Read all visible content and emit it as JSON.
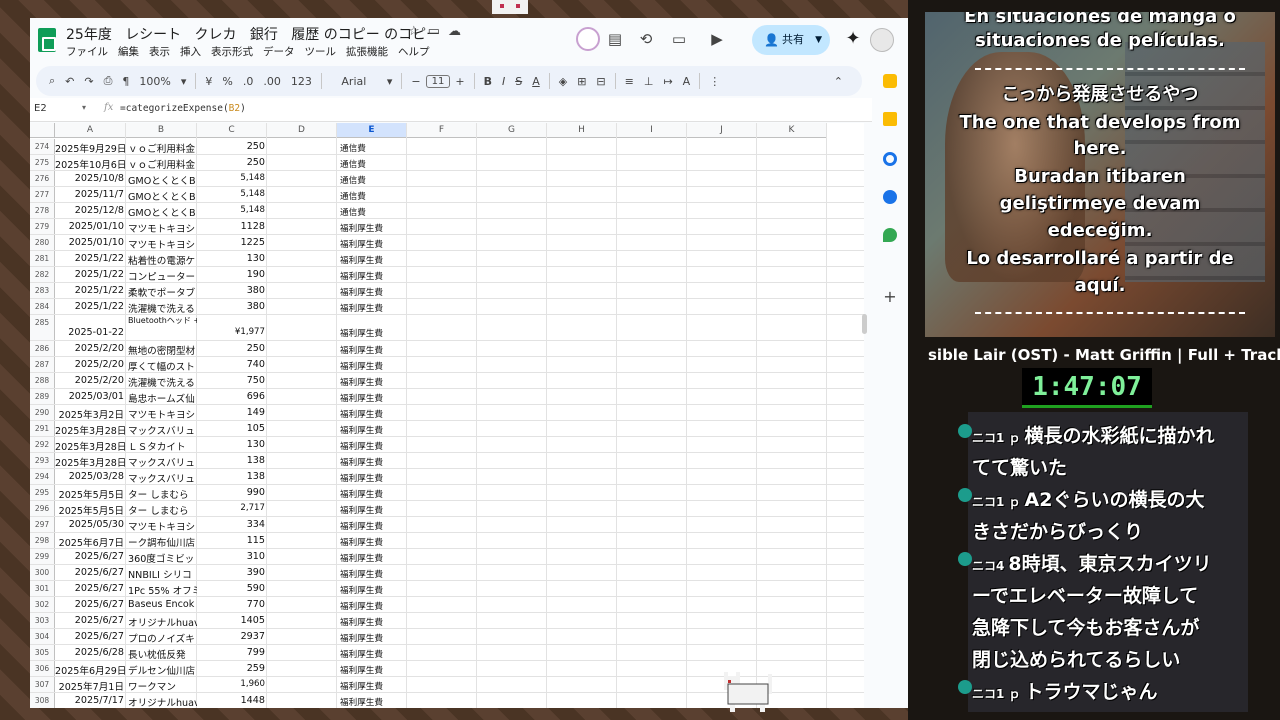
{
  "sheet": {
    "title_segments": [
      "25年度",
      "レシート",
      "クレカ",
      "銀行",
      "履歴 のコピー のコピー"
    ],
    "menu": [
      "ファイル",
      "編集",
      "表示",
      "挿入",
      "表示形式",
      "データ",
      "ツール",
      "拡張機能",
      "ヘルプ"
    ],
    "share_label": "共有",
    "toolbar": {
      "zoom": "100%",
      "currency": "¥",
      "percent": "%",
      "dec_decrease": ".0",
      "dec_increase": ".00",
      "number_format": "123",
      "font": "Arial",
      "font_size": "11"
    },
    "name_box": "E2",
    "formula_prefix": "=categorizeExpense(",
    "formula_ref": "B2",
    "formula_suffix": ")",
    "columns": [
      "A",
      "B",
      "C",
      "D",
      "E",
      "F",
      "G",
      "H",
      "I",
      "J",
      "K"
    ],
    "selected_column": "E",
    "rows": [
      {
        "n": "274",
        "a": "2025年9月29日",
        "b": "ｖｏご利用料金",
        "c": "250",
        "e": "通信費"
      },
      {
        "n": "275",
        "a": "2025年10月6日",
        "b": "ｖｏご利用料金",
        "c": "250",
        "e": "通信費"
      },
      {
        "n": "276",
        "a": "2025/10/8",
        "b": "GMOとくとくB",
        "c": "5,148",
        "e": "通信費"
      },
      {
        "n": "277",
        "a": "2025/11/7",
        "b": "GMOとくとくB",
        "c": "5,148",
        "e": "通信費"
      },
      {
        "n": "278",
        "a": "2025/12/8",
        "b": "GMOとくとくB",
        "c": "5,148",
        "e": "通信費"
      },
      {
        "n": "279",
        "a": "2025/01/10",
        "b": "マツモトキヨシ",
        "c": "1128",
        "e": "福利厚生費"
      },
      {
        "n": "280",
        "a": "2025/01/10",
        "b": "マツモトキヨシ",
        "c": "1225",
        "e": "福利厚生費"
      },
      {
        "n": "281",
        "a": "2025/1/22",
        "b": "粘着性の電源ケ",
        "c": "130",
        "e": "福利厚生費"
      },
      {
        "n": "282",
        "a": "2025/1/22",
        "b": "コンピューター",
        "c": "190",
        "e": "福利厚生費"
      },
      {
        "n": "283",
        "a": "2025/1/22",
        "b": "柔軟でポータブ",
        "c": "380",
        "e": "福利厚生費"
      },
      {
        "n": "284",
        "a": "2025/1/22",
        "b": "洗濯機で洗える",
        "c": "380",
        "e": "福利厚生費"
      },
      {
        "n": "285",
        "a": "2025-01-22",
        "b": "Bluetoothヘッド +1",
        "c": "¥1,977",
        "e": "福利厚生費",
        "tall": true
      },
      {
        "n": "286",
        "a": "2025/2/20",
        "b": "無地の密閉型材",
        "c": "250",
        "e": "福利厚生費"
      },
      {
        "n": "287",
        "a": "2025/2/20",
        "b": "厚くて幅のスト",
        "c": "740",
        "e": "福利厚生費"
      },
      {
        "n": "288",
        "a": "2025/2/20",
        "b": "洗濯機で洗える",
        "c": "750",
        "e": "福利厚生費"
      },
      {
        "n": "289",
        "a": "2025/03/01",
        "b": "島忠ホームズ仙",
        "c": "696",
        "e": "福利厚生費"
      },
      {
        "n": "290",
        "a": "2025年3月2日",
        "b": "マツモトキヨシ",
        "c": "149",
        "e": "福利厚生費"
      },
      {
        "n": "291",
        "a": "2025年3月28日",
        "b": "マックスバリュ",
        "c": "105",
        "e": "福利厚生費"
      },
      {
        "n": "292",
        "a": "2025年3月28日",
        "b": "ＬＳタカイト",
        "c": "130",
        "e": "福利厚生費"
      },
      {
        "n": "293",
        "a": "2025年3月28日",
        "b": "マックスバリュ",
        "c": "138",
        "e": "福利厚生費"
      },
      {
        "n": "294",
        "a": "2025/03/28",
        "b": "マックスバリュ",
        "c": "138",
        "e": "福利厚生費"
      },
      {
        "n": "295",
        "a": "2025年5月5日",
        "b": "ター しまむら",
        "c": "990",
        "e": "福利厚生費"
      },
      {
        "n": "296",
        "a": "2025年5月5日",
        "b": "ター しまむら",
        "c": "2,717",
        "e": "福利厚生費"
      },
      {
        "n": "297",
        "a": "2025/05/30",
        "b": "マツモトキヨシ",
        "c": "334",
        "e": "福利厚生費"
      },
      {
        "n": "298",
        "a": "2025年6月7日",
        "b": "ーク調布仙川店",
        "c": "115",
        "e": "福利厚生費"
      },
      {
        "n": "299",
        "a": "2025/6/27",
        "b": "360度ゴミビッ",
        "c": "310",
        "e": "福利厚生費"
      },
      {
        "n": "300",
        "a": "2025/6/27",
        "b": "NNBILI シリコ",
        "c": "390",
        "e": "福利厚生費"
      },
      {
        "n": "301",
        "a": "2025/6/27",
        "b": "1Pc 55% オフミ",
        "c": "590",
        "e": "福利厚生費"
      },
      {
        "n": "302",
        "a": "2025/6/27",
        "b": "Baseus Encok",
        "c": "770",
        "e": "福利厚生費"
      },
      {
        "n": "303",
        "a": "2025/6/27",
        "b": "オリジナルhuav",
        "c": "1405",
        "e": "福利厚生費"
      },
      {
        "n": "304",
        "a": "2025/6/27",
        "b": "プロのノイズキ",
        "c": "2937",
        "e": "福利厚生費"
      },
      {
        "n": "305",
        "a": "2025/6/28",
        "b": "長い枕低反発",
        "c": "799",
        "e": "福利厚生費"
      },
      {
        "n": "306",
        "a": "2025年6月29日",
        "b": "デルセン仙川店",
        "c": "259",
        "e": "福利厚生費"
      },
      {
        "n": "307",
        "a": "2025年7月1日",
        "b": "ワークマン",
        "c": "1,960",
        "e": "福利厚生費"
      },
      {
        "n": "308",
        "a": "2025/7/17",
        "b": "オリジナルhuav",
        "c": "1448",
        "e": "福利厚生費"
      }
    ]
  },
  "stream": {
    "subtitles_top": [
      "En situaciones de manga o",
      "situaciones de películas."
    ],
    "subtitles_main": [
      "こっから発展させるやつ",
      "The one that develops from",
      "here.",
      "Buradan itibaren",
      "geliştirmeye devam",
      "edeceğim.",
      "Lo desarrollaré a partir de",
      "aquí."
    ],
    "now_playing": "sible Lair (OST) - Matt Griffin | Full + Track",
    "timer": "1:47:07",
    "chat": [
      {
        "user": "ニコ1 ｐ",
        "text": "横長の水彩紙に描かれ"
      },
      {
        "user": "",
        "text": "てて驚いた"
      },
      {
        "user": "ニコ1 ｐ",
        "text": "A2ぐらいの横長の大"
      },
      {
        "user": "",
        "text": "きさだからびっくり"
      },
      {
        "user": "ニコ4",
        "text": "8時頃、東京スカイツリ"
      },
      {
        "user": "",
        "text": "ーでエレベーター故障して"
      },
      {
        "user": "",
        "text": "急降下して今もお客さんが"
      },
      {
        "user": "",
        "text": "閉じ込められてるらしい"
      },
      {
        "user": "ニコ1 ｐ",
        "text": "トラウマじゃん"
      }
    ]
  }
}
